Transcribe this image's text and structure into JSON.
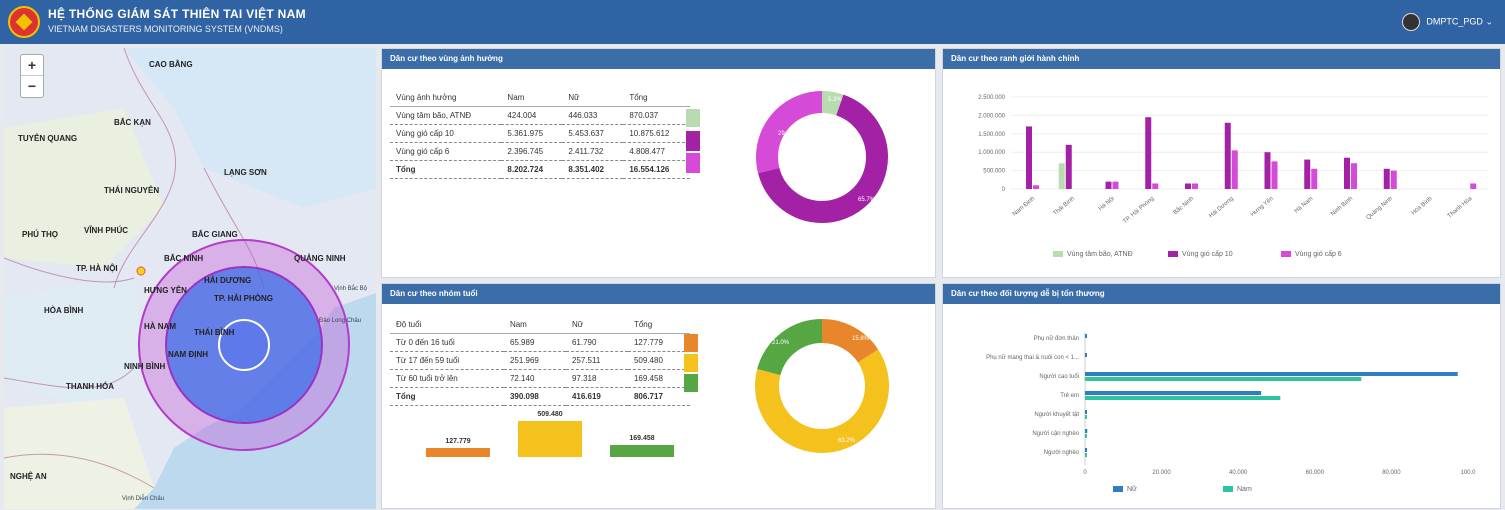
{
  "header": {
    "title": "HỆ THỐNG GIÁM SÁT THIÊN TAI VIỆT NAM",
    "subtitle": "VIETNAM DISASTERS MONITORING SYSTEM (VNDMS)",
    "user": "DMPTC_PGD"
  },
  "map": {
    "zoom_in": "+",
    "zoom_out": "−",
    "provinces": [
      "CAO BẰNG",
      "BẮC KẠN",
      "TUYÊN QUANG",
      "LẠNG SƠN",
      "THÁI NGUYÊN",
      "PHÚ THỌ",
      "VĨNH PHÚC",
      "BẮC GIANG",
      "TP. HÀ NỘI",
      "BẮC NINH",
      "QUẢNG NINH",
      "HẢI DƯƠNG",
      "HƯNG YÊN",
      "TP. HẢI PHÒNG",
      "HÒA BÌNH",
      "HÀ NAM",
      "THÁI BÌNH",
      "NAM ĐỊNH",
      "NINH BÌNH",
      "THANH HÓA",
      "NGHỆ AN"
    ],
    "seas": [
      "Vịnh Bắc Bộ",
      "Đảo Long Châu",
      "Vịnh Diễn Châu"
    ]
  },
  "panel1": {
    "title": "Dân cư theo vùng ảnh hưởng",
    "headers": [
      "Vùng ảnh hưởng",
      "Nam",
      "Nữ",
      "Tổng"
    ],
    "rows": [
      [
        "Vùng tâm bão, ATNĐ",
        "424.004",
        "446.033",
        "870.037"
      ],
      [
        "Vùng gió cấp 10",
        "5.361.975",
        "5.453.637",
        "10.875.612"
      ],
      [
        "Vùng gió cấp 6",
        "2.396.745",
        "2.411.732",
        "4.808.477"
      ]
    ],
    "total": [
      "Tổng",
      "8.202.724",
      "8.351.402",
      "16.554.126"
    ],
    "donut_labels": [
      "5.3%",
      "29.0%",
      "65.7%"
    ]
  },
  "panel2": {
    "title": "Dân cư theo ranh giới hành chính",
    "chart_data": {
      "type": "bar",
      "categories": [
        "Nam Định",
        "Thái Bình",
        "Hà Nội",
        "TP. Hải Phòng",
        "Bắc Ninh",
        "Hải Dương",
        "Hưng Yên",
        "Hà Nam",
        "Ninh Bình",
        "Quảng Ninh",
        "Hòa Bình",
        "Thanh Hóa"
      ],
      "series": [
        {
          "name": "Vùng tâm bão, ATNĐ",
          "values": [
            0,
            700000,
            0,
            0,
            0,
            0,
            0,
            0,
            0,
            0,
            0,
            0
          ]
        },
        {
          "name": "Vùng gió cấp 10",
          "values": [
            1700000,
            1200000,
            200000,
            1950000,
            150000,
            1800000,
            1000000,
            800000,
            850000,
            550000,
            0,
            0
          ]
        },
        {
          "name": "Vùng gió cấp 6",
          "values": [
            100000,
            0,
            200000,
            150000,
            150000,
            1050000,
            750000,
            550000,
            700000,
            500000,
            0,
            150000
          ]
        }
      ],
      "yticks": [
        "2.500.000",
        "2.000.000",
        "1.500.000",
        "1.000.000",
        "500.000",
        "0"
      ],
      "ylim": [
        0,
        2500000
      ],
      "colors": [
        "#b8dcb0",
        "#a321a4",
        "#d64ad8"
      ]
    }
  },
  "panel3": {
    "title": "Dân cư theo nhóm tuổi",
    "headers": [
      "Độ tuổi",
      "Nam",
      "Nữ",
      "Tổng"
    ],
    "rows": [
      [
        "Từ 0 đến 16 tuổi",
        "65.989",
        "61.790",
        "127.779"
      ],
      [
        "Từ 17 đến 59 tuổi",
        "251.969",
        "257.511",
        "509.480"
      ],
      [
        "Từ 60 tuổi trở lên",
        "72.140",
        "97.318",
        "169.458"
      ]
    ],
    "total": [
      "Tổng",
      "390.098",
      "416.619",
      "806.717"
    ],
    "bars": [
      {
        "label": "127.779",
        "value": 127779,
        "color": "#e8862c"
      },
      {
        "label": "509.480",
        "value": 509480,
        "color": "#f5c11d"
      },
      {
        "label": "169.458",
        "value": 169458,
        "color": "#56a744"
      }
    ],
    "donut_labels": [
      "15.8%",
      "63.2%",
      "21.0%"
    ]
  },
  "panel4": {
    "title": "Dân cư theo đối tượng dễ bị tổn thương",
    "chart_data": {
      "type": "bar",
      "categories": [
        "Phụ nữ đơn thân",
        "Phụ nữ mang thai & nuôi con < 1...",
        "Người cao tuổi",
        "Trẻ em",
        "Người khuyết tật",
        "Người cận nghèo",
        "Người nghèo"
      ],
      "series": [
        {
          "name": "Nữ",
          "values": [
            500,
            500,
            97318,
            46000,
            200,
            600,
            400
          ]
        },
        {
          "name": "Nam",
          "values": [
            0,
            0,
            72140,
            51000,
            200,
            300,
            300
          ]
        }
      ],
      "xticks": [
        "0",
        "20.000",
        "40.000",
        "60.000",
        "80.000",
        "100.0"
      ],
      "xlim": [
        0,
        100000
      ],
      "colors": [
        "#2d7fc1",
        "#2fc4a0"
      ]
    }
  }
}
